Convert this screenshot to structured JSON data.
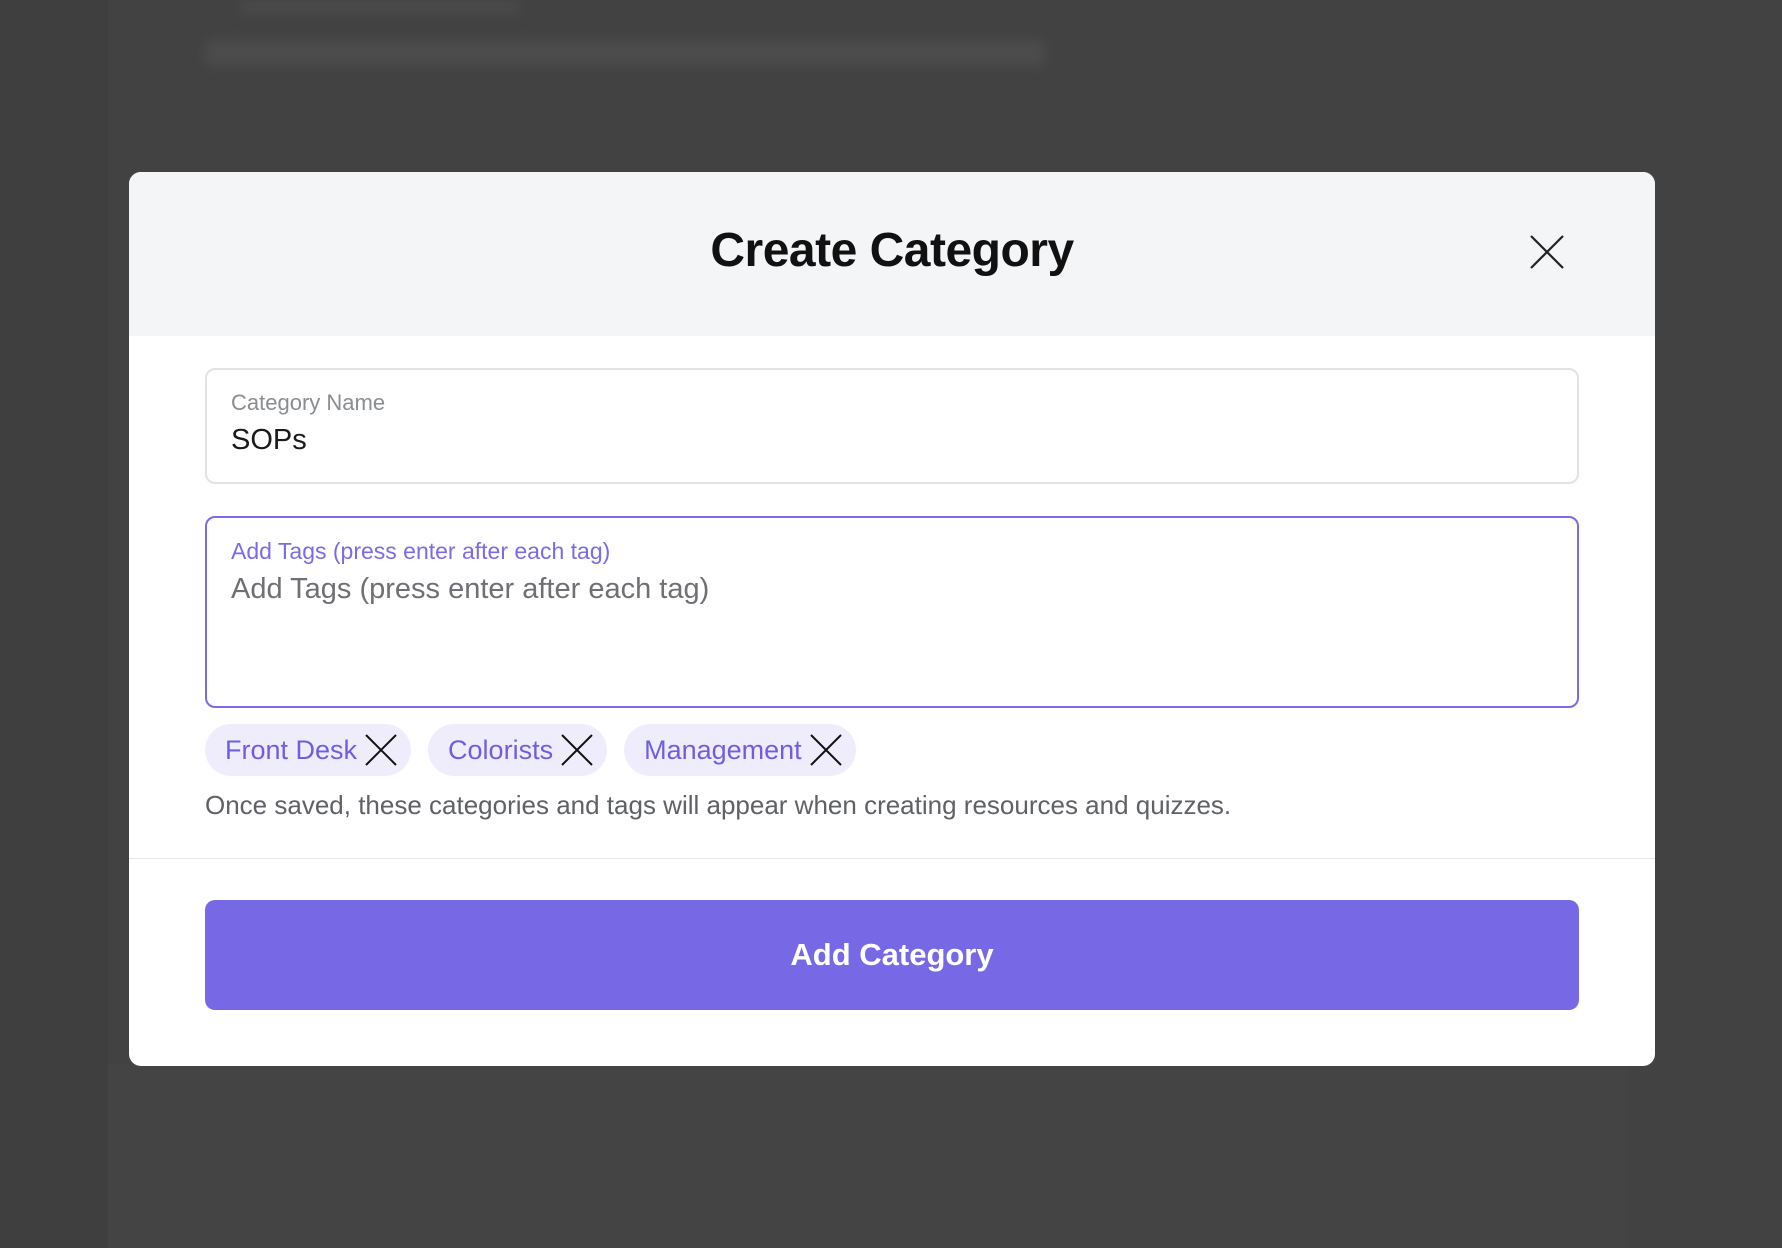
{
  "modal": {
    "title": "Create Category",
    "close_icon": "close-icon"
  },
  "category_name": {
    "label": "Category Name",
    "value": "SOPs"
  },
  "tags": {
    "label": "Add Tags (press enter after each tag)",
    "placeholder": "Add Tags (press enter after each tag)",
    "items": [
      {
        "label": "Front Desk"
      },
      {
        "label": "Colorists"
      },
      {
        "label": "Management"
      }
    ],
    "remove_icon": "close-icon"
  },
  "helper_text": "Once saved, these categories and tags will appear when creating resources and quizzes.",
  "submit": {
    "label": "Add Category"
  },
  "colors": {
    "accent": "#7769e6",
    "chip_bg": "#efedfc",
    "overlay": "#424242"
  }
}
